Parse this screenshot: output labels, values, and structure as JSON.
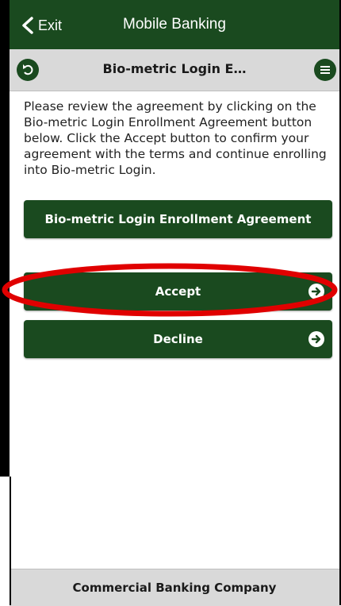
{
  "header": {
    "exit_label": "Exit",
    "title": "Mobile Banking"
  },
  "subheader": {
    "title": "Bio-metric Login E…"
  },
  "content": {
    "instructions": "Please review the agreement by clicking on the Bio-metric Login Enrollment Agreement button below. Click the Accept button to confirm your agreement with the terms and continue enrolling into Bio-metric Login.",
    "agreement_button": "Bio-metric Login Enrollment Agreement",
    "accept_button": "Accept",
    "decline_button": "Decline"
  },
  "footer": {
    "company": "Commercial Banking Company"
  },
  "icons": {
    "exit": "chevron-left-icon",
    "back": "back-arrow-icon",
    "menu": "hamburger-menu-icon",
    "arrow": "arrow-right-icon"
  },
  "colors": {
    "brand_green": "#1a4a1f",
    "bar_gray": "#d9d9d9",
    "highlight_red": "#e00000"
  }
}
